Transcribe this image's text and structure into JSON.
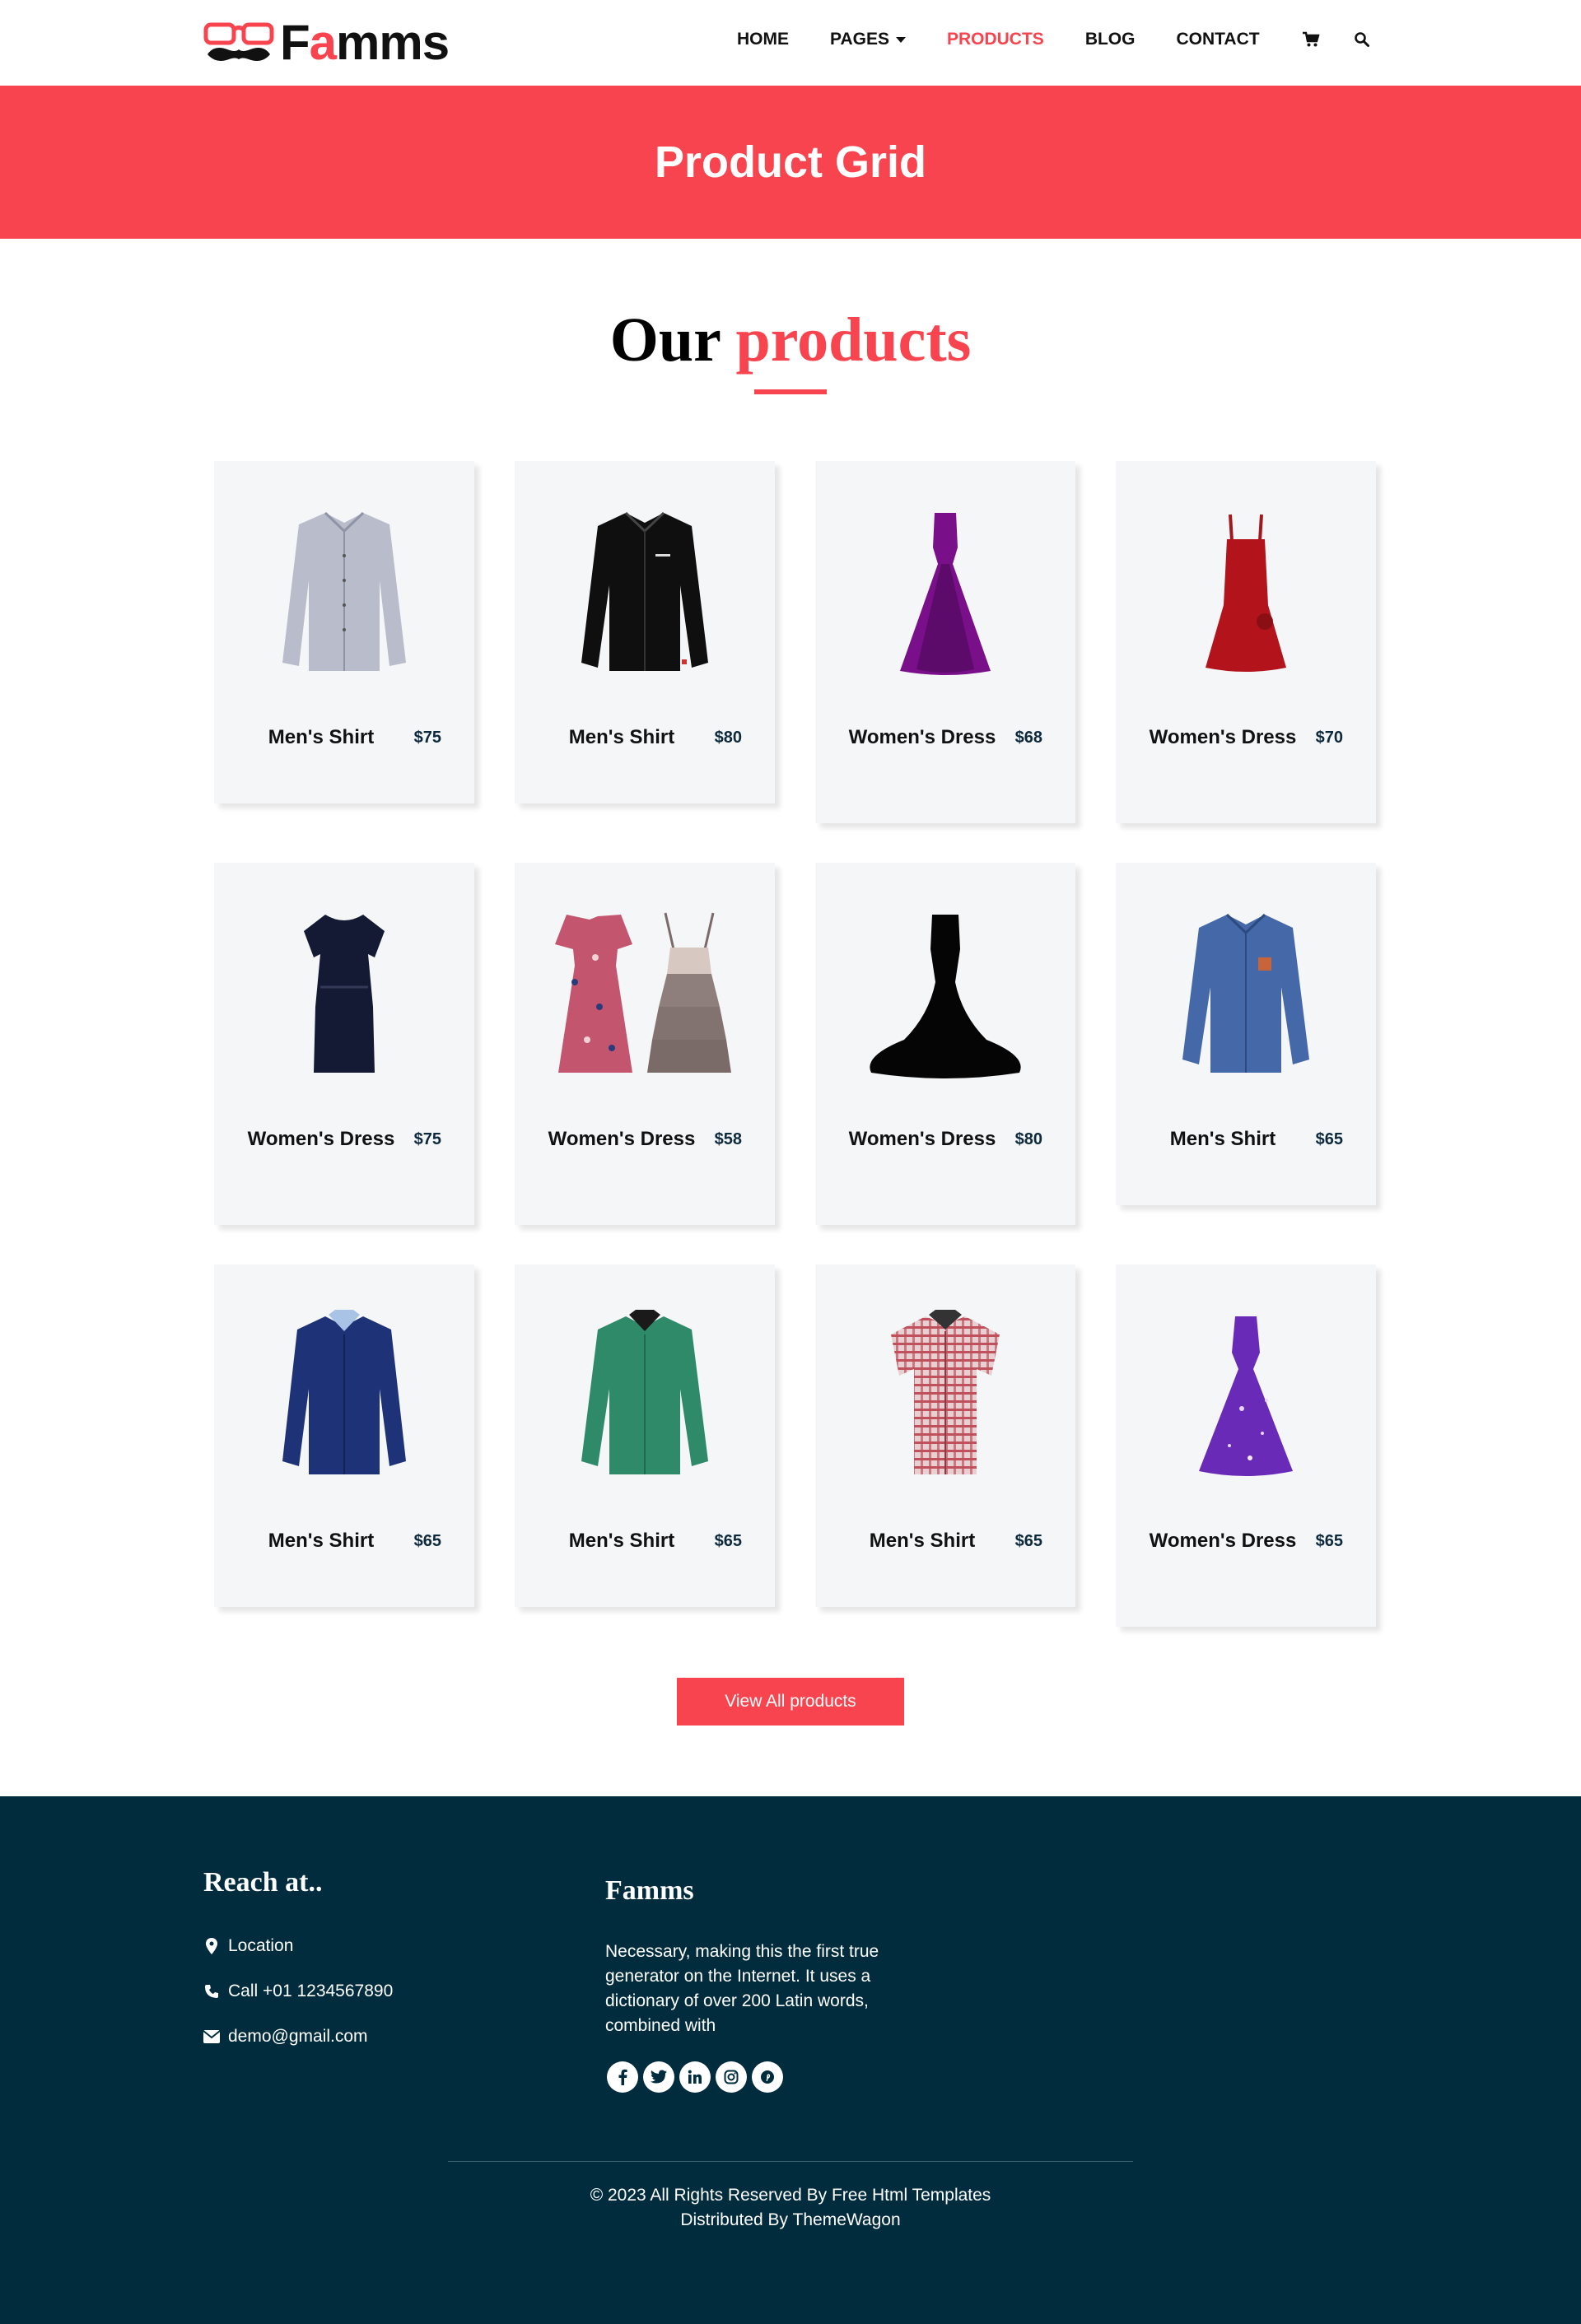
{
  "brand": {
    "name_before": "F",
    "name_accent": "a",
    "name_after": "mms"
  },
  "nav": {
    "home": "HOME",
    "pages": "PAGES",
    "products": "PRODUCTS",
    "blog": "BLOG",
    "contact": "CONTACT"
  },
  "banner": {
    "title": "Product Grid"
  },
  "section": {
    "title_plain": "Our",
    "title_accent": "products"
  },
  "products": [
    {
      "name": "Men's Shirt",
      "price": "$75",
      "icon": "light-gray-mens-shirt"
    },
    {
      "name": "Men's Shirt",
      "price": "$80",
      "icon": "black-mens-shirt"
    },
    {
      "name": "Women's Dress",
      "price": "$68",
      "icon": "purple-gown"
    },
    {
      "name": "Women's Dress",
      "price": "$70",
      "icon": "red-dress"
    },
    {
      "name": "Women's Dress",
      "price": "$75",
      "icon": "navy-dress"
    },
    {
      "name": "Women's Dress",
      "price": "$58",
      "icon": "floral-and-tiered-dresses"
    },
    {
      "name": "Women's Dress",
      "price": "$80",
      "icon": "black-gown"
    },
    {
      "name": "Men's Shirt",
      "price": "$65",
      "icon": "blue-denim-shirt"
    },
    {
      "name": "Men's Shirt",
      "price": "$65",
      "icon": "navy-mens-shirt"
    },
    {
      "name": "Men's Shirt",
      "price": "$65",
      "icon": "green-mens-shirt"
    },
    {
      "name": "Men's Shirt",
      "price": "$65",
      "icon": "plaid-short-sleeve-shirt"
    },
    {
      "name": "Women's Dress",
      "price": "$65",
      "icon": "galaxy-purple-gown"
    }
  ],
  "cta": {
    "label": "View All products"
  },
  "footer": {
    "reach_title": "Reach at..",
    "location": "Location",
    "phone": "Call +01 1234567890",
    "email": "demo@gmail.com",
    "brand_title": "Famms",
    "about": "Necessary, making this the first true generator on the Internet. It uses a dictionary of over 200 Latin words, combined with",
    "socials": [
      "facebook-icon",
      "twitter-icon",
      "linkedin-icon",
      "instagram-icon",
      "pinterest-icon"
    ],
    "copyright_line1": "© 2023 All Rights Reserved By Free Html Templates",
    "copyright_line2": "Distributed By ThemeWagon"
  },
  "colors": {
    "accent": "#f7444e",
    "footer_bg": "#002c3e",
    "card_bg": "#f5f6f8"
  }
}
